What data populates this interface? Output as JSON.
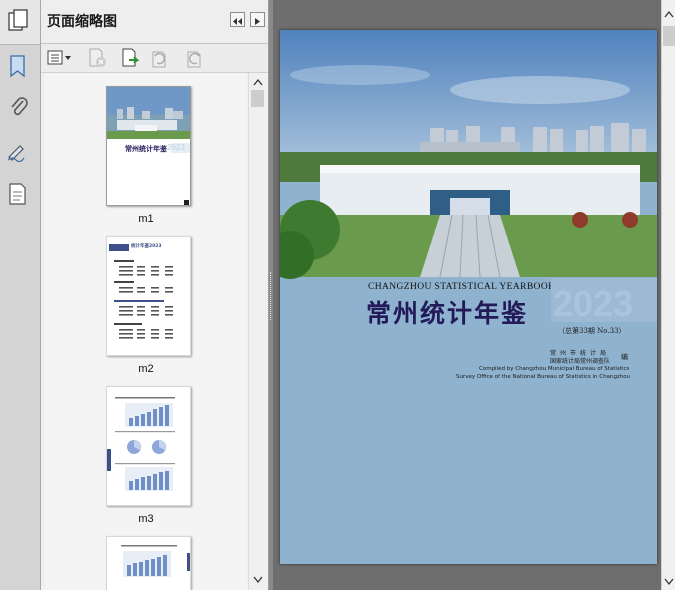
{
  "panel": {
    "title": "页面缩略图"
  },
  "thumbnails": [
    {
      "label": "m1"
    },
    {
      "label": "m2"
    },
    {
      "label": "m3"
    }
  ],
  "thumb1": {
    "cn_title": "常州统计年鉴",
    "year": "2023"
  },
  "thumb2": {
    "header": "统计年鉴2023"
  },
  "cover": {
    "en_title": "CHANGZHOU STATISTICAL YEARBOOK",
    "cn_title": "常州统计年鉴",
    "year": "2023",
    "issue": "（总第33期 No.33）",
    "org1": "常州市统计局",
    "org2": "国家统计局常州调查队",
    "edit_mark": "编",
    "credit_en1": "Compiled by Changzhou Municipal Bureau of Statistics",
    "credit_en2": "Survey Office of the National Bureau of Statistics in Changzhou"
  },
  "colors": {
    "sky": "#5f8fc3",
    "cover_blue": "#8fb3cf",
    "title_navy": "#231a5a"
  }
}
